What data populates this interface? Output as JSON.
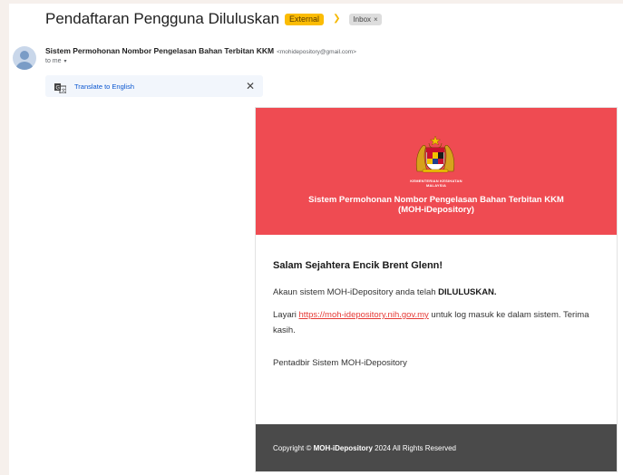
{
  "email": {
    "subject": "Pendaftaran Pengguna Diluluskan",
    "labels": {
      "external": "External",
      "inbox": "Inbox",
      "remove": "×"
    },
    "sender": {
      "name": "Sistem Permohonan Nombor Pengelasan Bahan Terbitan KKM",
      "email": "<mohidepository@gmail.com>",
      "to": "to me",
      "caret": "▾"
    },
    "translate": {
      "label": "Translate to English",
      "close": "✕"
    }
  },
  "card": {
    "ministry_line1": "KEMENTERIAN KESIHATAN",
    "ministry_line2": "MALAYSIA",
    "title_line1": "Sistem Permohonan Nombor Pengelasan Bahan Terbitan KKM",
    "title_line2": "(MOH-iDepository)",
    "greeting": "Salam Sejahtera Encik Brent Glenn!",
    "line1_prefix": "Akaun sistem MOH-iDepository anda telah",
    "line1_bold": "DILULUSKAN.",
    "line2_prefix": "Layari",
    "link": "https://moh-idepository.nih.gov.my",
    "line2_suffix": "untuk log masuk ke dalam sistem. Terima kasih.",
    "signature": "Pentadbir Sistem MOH-iDepository",
    "footer_prefix": "Copyright ©",
    "footer_bold": "MOH-iDepository",
    "footer_suffix": "2024 All Rights Reserved"
  },
  "colors": {
    "header_red": "#ef4b52",
    "footer_gray": "#4a4a4a",
    "external_label": "#fbbc04",
    "link_red": "#e53935"
  },
  "icons": [
    "important-marker-icon",
    "translate-icon",
    "close-icon",
    "avatar-icon",
    "crest-icon"
  ]
}
